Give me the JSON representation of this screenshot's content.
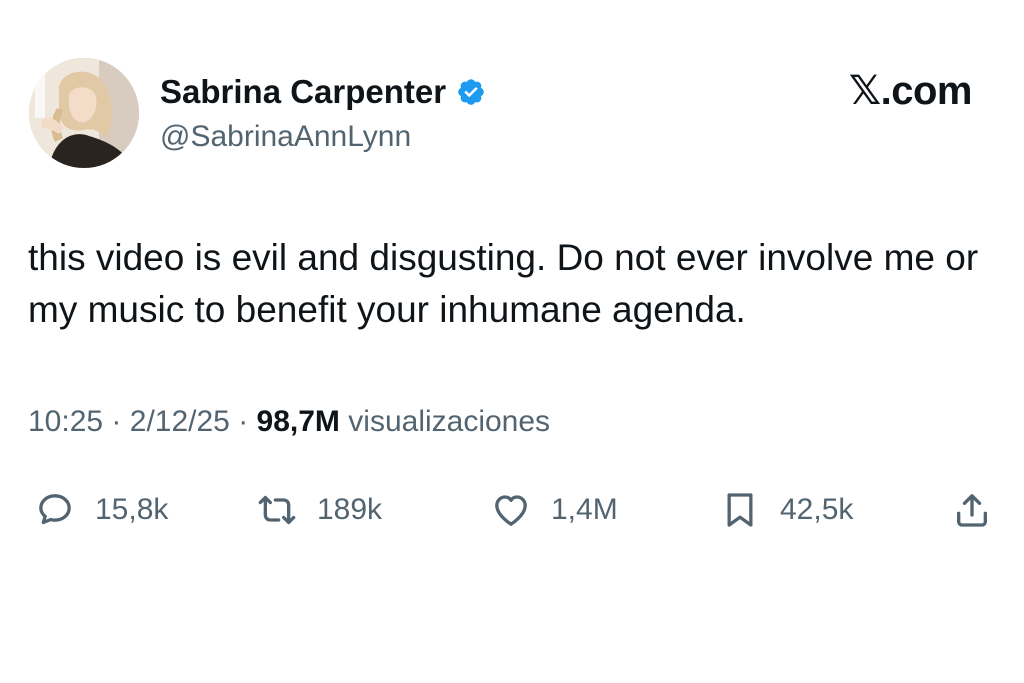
{
  "author": {
    "display_name": "Sabrina Carpenter",
    "handle": "@SabrinaAnnLynn",
    "verified": true,
    "avatar_icon": "profile-photo"
  },
  "brand": {
    "label": "𝕏.com"
  },
  "tweet": {
    "text": "this video is evil and disgusting. Do not ever involve me or my music to benefit your inhumane agenda."
  },
  "meta": {
    "time": "10:25",
    "separator": "·",
    "date": "2/12/25",
    "views_count": "98,7M",
    "views_label": "visualizaciones"
  },
  "actions": {
    "reply": {
      "icon": "reply-icon",
      "count": "15,8k"
    },
    "repost": {
      "icon": "repost-icon",
      "count": "189k"
    },
    "like": {
      "icon": "heart-icon",
      "count": "1,4M"
    },
    "bookmark": {
      "icon": "bookmark-icon",
      "count": "42,5k"
    },
    "share": {
      "icon": "share-icon"
    }
  },
  "colors": {
    "text_primary": "#0f1419",
    "text_secondary": "#536471",
    "verified_badge": "#1d9bf0"
  }
}
